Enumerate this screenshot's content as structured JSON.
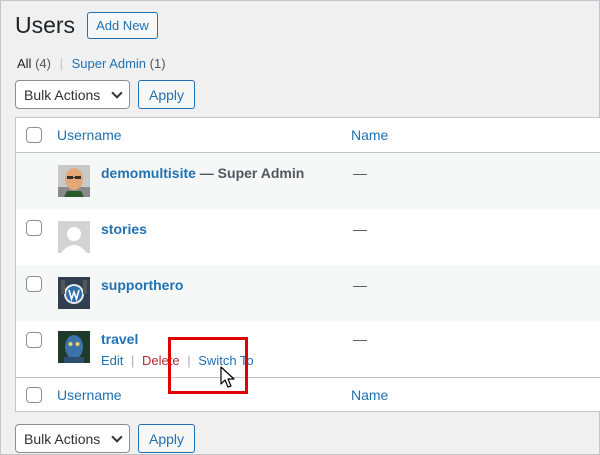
{
  "header": {
    "title": "Users",
    "add_new": "Add New"
  },
  "filters": {
    "all_label": "All",
    "all_count": "(4)",
    "separator": "|",
    "super_admin_label": "Super Admin",
    "super_admin_count": "(1)"
  },
  "bulk": {
    "label": "Bulk Actions",
    "apply": "Apply"
  },
  "table": {
    "columns": {
      "username": "Username",
      "name": "Name"
    },
    "rows": [
      {
        "username": "demomultisite",
        "role": " — Super Admin",
        "name": "—"
      },
      {
        "username": "stories",
        "name": "—"
      },
      {
        "username": "supporthero",
        "name": "—"
      },
      {
        "username": "travel",
        "name": "—",
        "actions": {
          "edit": "Edit",
          "separator": "|",
          "delete": "Delete",
          "switch": "Switch To"
        }
      }
    ]
  },
  "colors": {
    "link": "#2271b1",
    "delete": "#b32d2e",
    "highlight": "#e00000"
  },
  "icons": [
    "chevron-down-icon",
    "cursor-icon",
    "default-avatar-icon"
  ]
}
